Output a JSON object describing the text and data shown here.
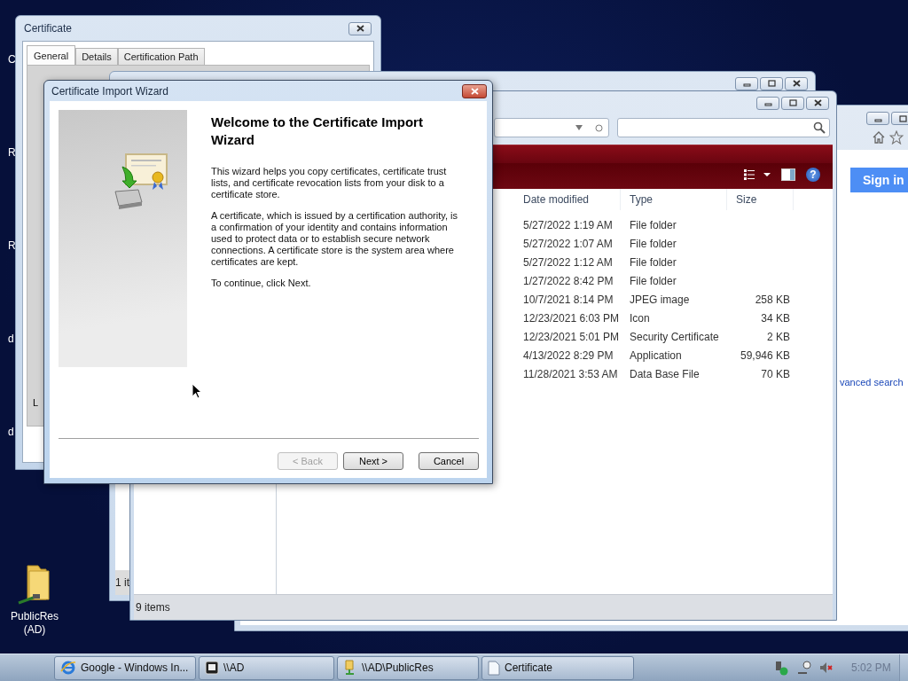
{
  "desktop": {
    "edge_labels": [
      "C",
      "R",
      "R",
      "d",
      "d"
    ],
    "icons": [
      {
        "label": "PublicRes (AD)"
      }
    ]
  },
  "certificate_window": {
    "title": "Certificate",
    "tabs": [
      {
        "label": "General",
        "selected": true
      },
      {
        "label": "Details",
        "selected": false
      },
      {
        "label": "Certification Path",
        "selected": false
      }
    ],
    "cut_text": "L"
  },
  "back_explorer": {
    "status": "1 it"
  },
  "browser": {
    "sign_in": "Sign in",
    "link": "vanced search"
  },
  "explorer": {
    "help": "?",
    "columns": [
      "Date modified",
      "Type",
      "Size"
    ],
    "rows": [
      {
        "date": "5/27/2022 1:19 AM",
        "type": "File folder",
        "size": ""
      },
      {
        "date": "5/27/2022 1:07 AM",
        "type": "File folder",
        "size": ""
      },
      {
        "date": "5/27/2022 1:12 AM",
        "type": "File folder",
        "size": ""
      },
      {
        "date": "1/27/2022 8:42 PM",
        "type": "File folder",
        "size": ""
      },
      {
        "date": "10/7/2021 8:14 PM",
        "type": "JPEG image",
        "size": "258 KB"
      },
      {
        "date": "12/23/2021 6:03 PM",
        "type": "Icon",
        "size": "34 KB"
      },
      {
        "date": "12/23/2021 5:01 PM",
        "type": "Security Certificate",
        "size": "2 KB"
      },
      {
        "date": "4/13/2022 8:29 PM",
        "type": "Application",
        "size": "59,946 KB"
      },
      {
        "date": "11/28/2021 3:53 AM",
        "type": "Data Base File",
        "size": "70 KB"
      }
    ],
    "status": "9 items"
  },
  "wizard": {
    "title": "Certificate Import Wizard",
    "heading": "Welcome to the Certificate Import Wizard",
    "paragraphs": [
      "This wizard helps you copy certificates, certificate trust lists, and certificate revocation lists from your disk to a certificate store.",
      "A certificate, which is issued by a certification authority, is a confirmation of your identity and contains information used to protect data or to establish secure network connections. A certificate store is the system area where certificates are kept.",
      "To continue, click Next."
    ],
    "buttons": [
      {
        "label": "< Back",
        "disabled": true
      },
      {
        "label": "Next >",
        "disabled": false
      },
      {
        "label": "Cancel",
        "disabled": false
      }
    ]
  },
  "taskbar": {
    "items": [
      {
        "kind": "browser",
        "label": "Google - Windows In..."
      },
      {
        "kind": "console",
        "label": "\\\\AD"
      },
      {
        "kind": "folder",
        "label": "\\\\AD\\PublicRes"
      },
      {
        "kind": "document",
        "label": "Certificate"
      }
    ],
    "clock": "5:02 PM"
  }
}
